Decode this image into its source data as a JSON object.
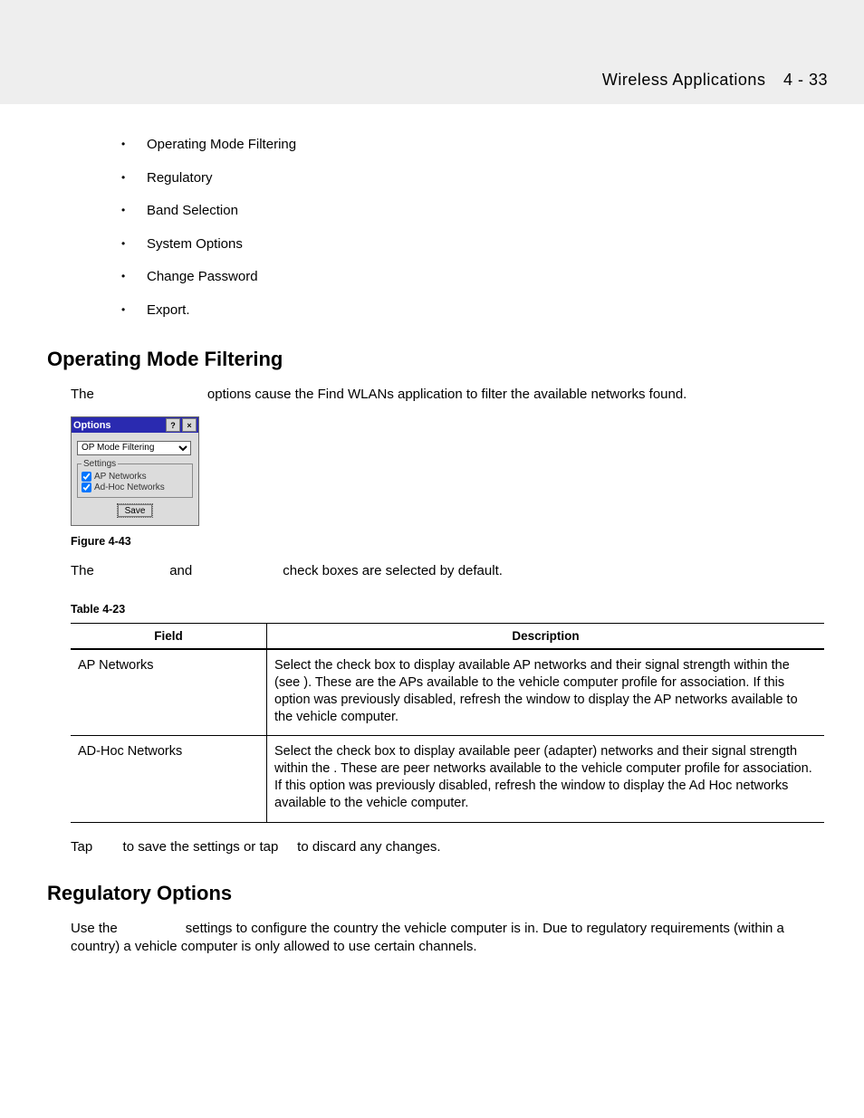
{
  "header": {
    "section": "Wireless Applications",
    "pageref": "4 - 33"
  },
  "bullets": [
    "Operating Mode Filtering",
    "Regulatory",
    "Band Selection",
    "System Options",
    "Change Password",
    "Export."
  ],
  "s1": {
    "heading": "Operating Mode Filtering",
    "p1a": "The ",
    "p1b": " options cause the Find WLANs application to filter the available networks found.",
    "dialog": {
      "title": "Options",
      "help": "?",
      "close": "×",
      "dropdown": "OP Mode Filtering",
      "legend": "Settings",
      "cb1": "AP Networks",
      "cb2": "Ad-Hoc Networks",
      "save": "Save"
    },
    "figcap": "Figure 4-43",
    "p2a": "The ",
    "p2b": " and ",
    "p2c": " check boxes are selected by default.",
    "tblcap": "Table 4-23",
    "th1": "Field",
    "th2": "Description",
    "r1f": "AP Networks",
    "r1d": "Select the                      check box to display available AP networks and their signal strength within the                                              (see                                                   ). These are the APs available to the vehicle computer profile for association. If this option was previously disabled, refresh the                          window to display the AP networks available to the vehicle computer.",
    "r2f": "AD-Hoc Networks",
    "r2d": "Select the                             check box to display available peer (adapter) networks and their signal strength within the                                               . These are peer networks available to the vehicle computer profile for association. If this option was previously disabled, refresh the                                              window to display the Ad Hoc networks available to the vehicle computer.",
    "save_note_a": "Tap ",
    "save_note_b": " to save the settings or tap ",
    "save_note_c": " to discard any changes."
  },
  "s2": {
    "heading": "Regulatory Options",
    "p1a": "Use the ",
    "p1b": " settings to configure the country the vehicle computer is in. Due to regulatory requirements (within a country) a vehicle computer is only allowed to use certain channels."
  }
}
